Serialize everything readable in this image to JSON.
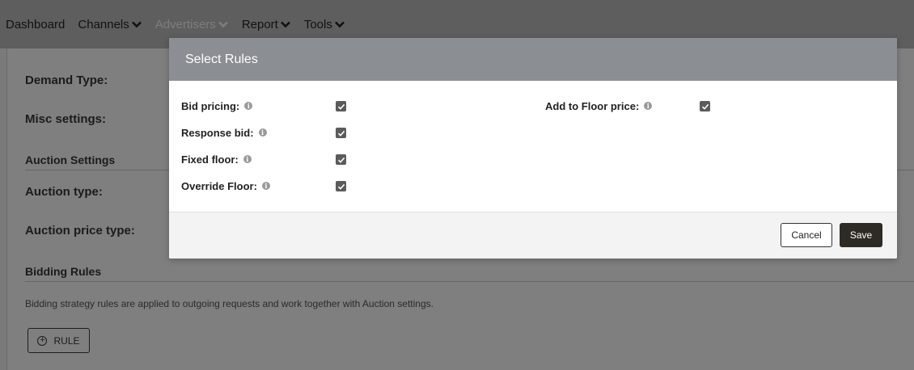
{
  "nav": {
    "items": [
      {
        "label": "Dashboard",
        "has_menu": false,
        "disabled": false
      },
      {
        "label": "Channels",
        "has_menu": true,
        "disabled": false
      },
      {
        "label": "Advertisers",
        "has_menu": true,
        "disabled": true
      },
      {
        "label": "Report",
        "has_menu": true,
        "disabled": false
      },
      {
        "label": "Tools",
        "has_menu": true,
        "disabled": false
      }
    ]
  },
  "page": {
    "demand_type_label": "Demand Type:",
    "misc_settings_label": "Misc settings:",
    "auction_settings_title": "Auction Settings",
    "auction_type_label": "Auction type:",
    "auction_price_type_label": "Auction price type:",
    "bidding_rules_title": "Bidding Rules",
    "bidding_rules_help": "Bidding strategy rules are applied to outgoing requests and work together with Auction settings.",
    "rule_button_label": "RULE"
  },
  "modal": {
    "title": "Select Rules",
    "rules": [
      {
        "label": "Bid pricing:",
        "checked": true
      },
      {
        "label": "Response bid:",
        "checked": true
      },
      {
        "label": "Fixed floor:",
        "checked": true
      },
      {
        "label": "Override Floor:",
        "checked": true
      },
      {
        "label": "Add to Floor price:",
        "checked": true
      }
    ],
    "cancel_label": "Cancel",
    "save_label": "Save"
  },
  "colors": {
    "overlay": "#7a7a7a",
    "modal_header": "#8b8e92",
    "save_button": "#2e2a26",
    "checkbox": "#5b5b5b"
  }
}
